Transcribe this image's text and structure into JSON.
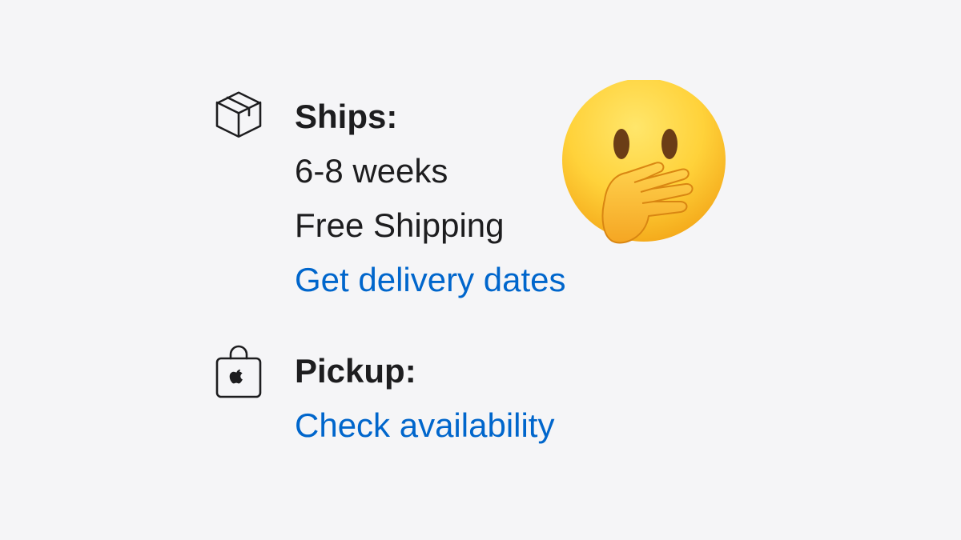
{
  "ships": {
    "icon": "box-icon",
    "heading": "Ships:",
    "lead_time": "6-8 weeks",
    "shipping": "Free Shipping",
    "link": "Get delivery dates"
  },
  "pickup": {
    "icon": "shopping-bag-icon",
    "heading": "Pickup:",
    "link": "Check availability"
  },
  "sticker": {
    "icon": "face-with-hand-over-mouth-emoji"
  },
  "colors": {
    "background": "#f5f5f7",
    "text": "#1d1d1f",
    "link": "#0066cc"
  }
}
